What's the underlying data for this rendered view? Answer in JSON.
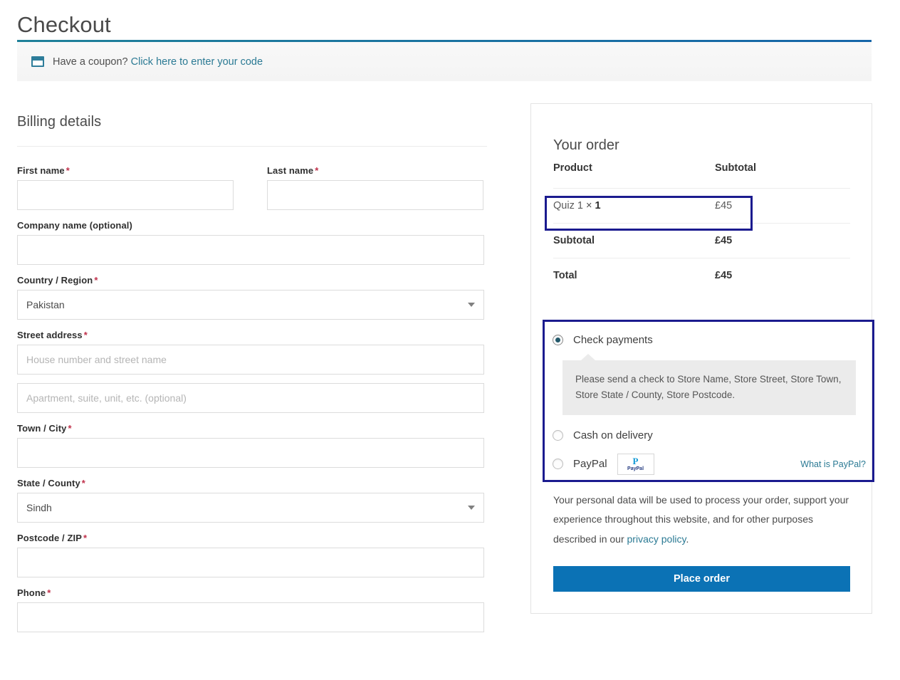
{
  "page": {
    "title": "Checkout"
  },
  "coupon": {
    "icon": "coupon-ticket-icon",
    "text": "Have a coupon?",
    "link_label": "Click here to enter your code"
  },
  "billing": {
    "heading": "Billing details",
    "fields": [
      {
        "label": "First name",
        "required": true,
        "value": "",
        "placeholder": ""
      },
      {
        "label": "Last name",
        "required": true,
        "value": "",
        "placeholder": ""
      },
      {
        "label": "Company name (optional)",
        "required": false,
        "value": "",
        "placeholder": ""
      },
      {
        "label": "Country / Region",
        "required": true,
        "value": "Pakistan",
        "type": "select"
      },
      {
        "label": "Street address",
        "required": true,
        "value": "",
        "placeholder": "House number and street name"
      },
      {
        "label": "",
        "required": false,
        "value": "",
        "placeholder": "Apartment, suite, unit, etc. (optional)"
      },
      {
        "label": "Town / City",
        "required": true,
        "value": "",
        "placeholder": ""
      },
      {
        "label": "State / County",
        "required": true,
        "value": "Sindh",
        "type": "select"
      },
      {
        "label": "Postcode / ZIP",
        "required": true,
        "value": "",
        "placeholder": ""
      },
      {
        "label": "Phone",
        "required": true,
        "value": "",
        "placeholder": ""
      }
    ],
    "required_marker": "*"
  },
  "order": {
    "heading": "Your order",
    "columns": {
      "product": "Product",
      "subtotal": "Subtotal"
    },
    "items": [
      {
        "name": "Quiz 1",
        "qty_symbol": "×",
        "qty": "1",
        "amount": "£45"
      }
    ],
    "rows": [
      {
        "label": "Subtotal",
        "amount": "£45"
      },
      {
        "label": "Total",
        "amount": "£45"
      }
    ]
  },
  "payment": {
    "methods": [
      {
        "id": "cheque",
        "label": "Check payments",
        "selected": true
      },
      {
        "id": "cod",
        "label": "Cash on delivery",
        "selected": false
      },
      {
        "id": "paypal",
        "label": "PayPal",
        "selected": false
      }
    ],
    "cheque_instructions": "Please send a check to Store Name, Store Street, Store Town, Store State / County, Store Postcode.",
    "paypal_logo_mark": "P",
    "paypal_logo_word": "PayPal",
    "what_is_paypal": "What is PayPal?"
  },
  "privacy": {
    "text_before": "Your personal data will be used to process your order, support your experience throughout this website, and for other purposes described in our ",
    "link_label": "privacy policy",
    "text_after": "."
  },
  "actions": {
    "place_order": "Place order"
  },
  "colors": {
    "accent_blue": "#0b72b5",
    "link_teal": "#2b7a94",
    "highlight_navy": "#1b1b8f",
    "required_red": "#c0314b",
    "coupon_border": "#1f8199"
  }
}
